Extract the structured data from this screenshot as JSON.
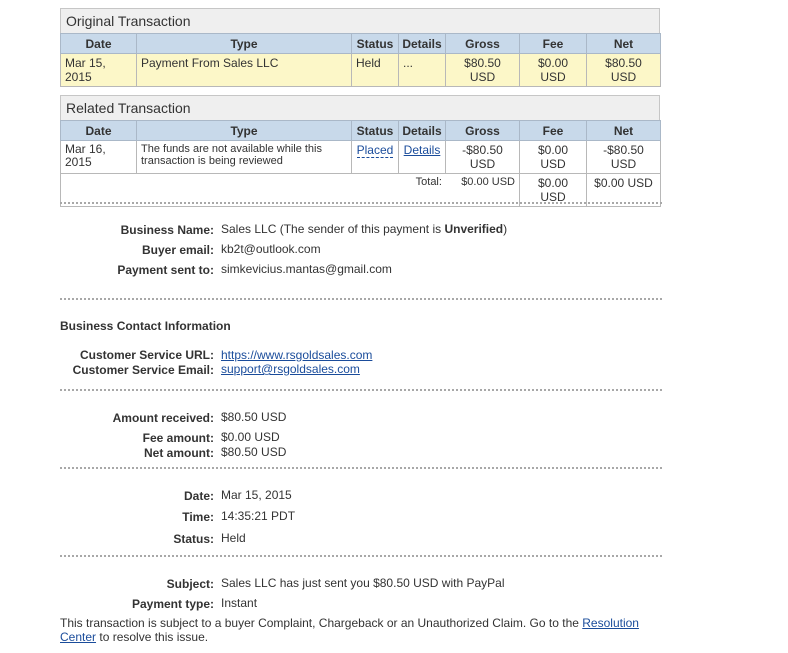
{
  "original": {
    "title": "Original Transaction",
    "headers": [
      "Date",
      "Type",
      "Status",
      "Details",
      "Gross",
      "Fee",
      "Net"
    ],
    "row": {
      "date": "Mar 15, 2015",
      "type": "Payment From Sales LLC",
      "status": "Held",
      "details": "...",
      "gross": "$80.50 USD",
      "fee": "$0.00 USD",
      "net": "$80.50 USD"
    }
  },
  "related": {
    "title": "Related Transaction",
    "headers": [
      "Date",
      "Type",
      "Status",
      "Details",
      "Gross",
      "Fee",
      "Net"
    ],
    "row": {
      "date": "Mar 16, 2015",
      "type": "The funds are not available while this transaction is being reviewed",
      "status": "Placed",
      "details": "Details",
      "gross": "-$80.50 USD",
      "fee": "$0.00 USD",
      "net": "-$80.50 USD"
    },
    "total": {
      "label": "Total:",
      "gross": "$0.00 USD",
      "fee": "$0.00 USD",
      "net": "$0.00 USD"
    }
  },
  "sender": {
    "business_name_label": "Business Name:",
    "business_name_value": "Sales LLC (The sender of this payment is ",
    "verification": "Unverified",
    "close_paren": ")",
    "buyer_email_label": "Buyer email:",
    "buyer_email": "kb2t@outlook.com",
    "sent_to_label": "Payment sent to:",
    "sent_to": "simkevicius.mantas@gmail.com"
  },
  "contact": {
    "heading": "Business Contact Information",
    "url_label": "Customer Service URL:",
    "url": "https://www.rsgoldsales.com",
    "email_label": "Customer Service Email:",
    "email": "support@rsgoldsales.com"
  },
  "amounts": {
    "received_label": "Amount received:",
    "received": "$80.50 USD",
    "fee_label": "Fee amount:",
    "fee": "$0.00 USD",
    "net_label": "Net amount:",
    "net": "$80.50 USD"
  },
  "timing": {
    "date_label": "Date:",
    "date": "Mar 15, 2015",
    "time_label": "Time:",
    "time": "14:35:21 PDT",
    "status_label": "Status:",
    "status": "Held"
  },
  "message": {
    "subject_label": "Subject:",
    "subject": "Sales LLC has just sent you $80.50 USD with PayPal",
    "payment_type_label": "Payment type:",
    "payment_type": "Instant",
    "notice_before": "This transaction is subject to a buyer Complaint, Chargeback or an Unauthorized Claim. Go to the ",
    "notice_link": "Resolution Center",
    "notice_after": " to resolve this issue."
  },
  "colors": {
    "header_bg": "#c8d9ea",
    "highlight_row": "#fcf7c8",
    "link": "#1a4c9b"
  }
}
